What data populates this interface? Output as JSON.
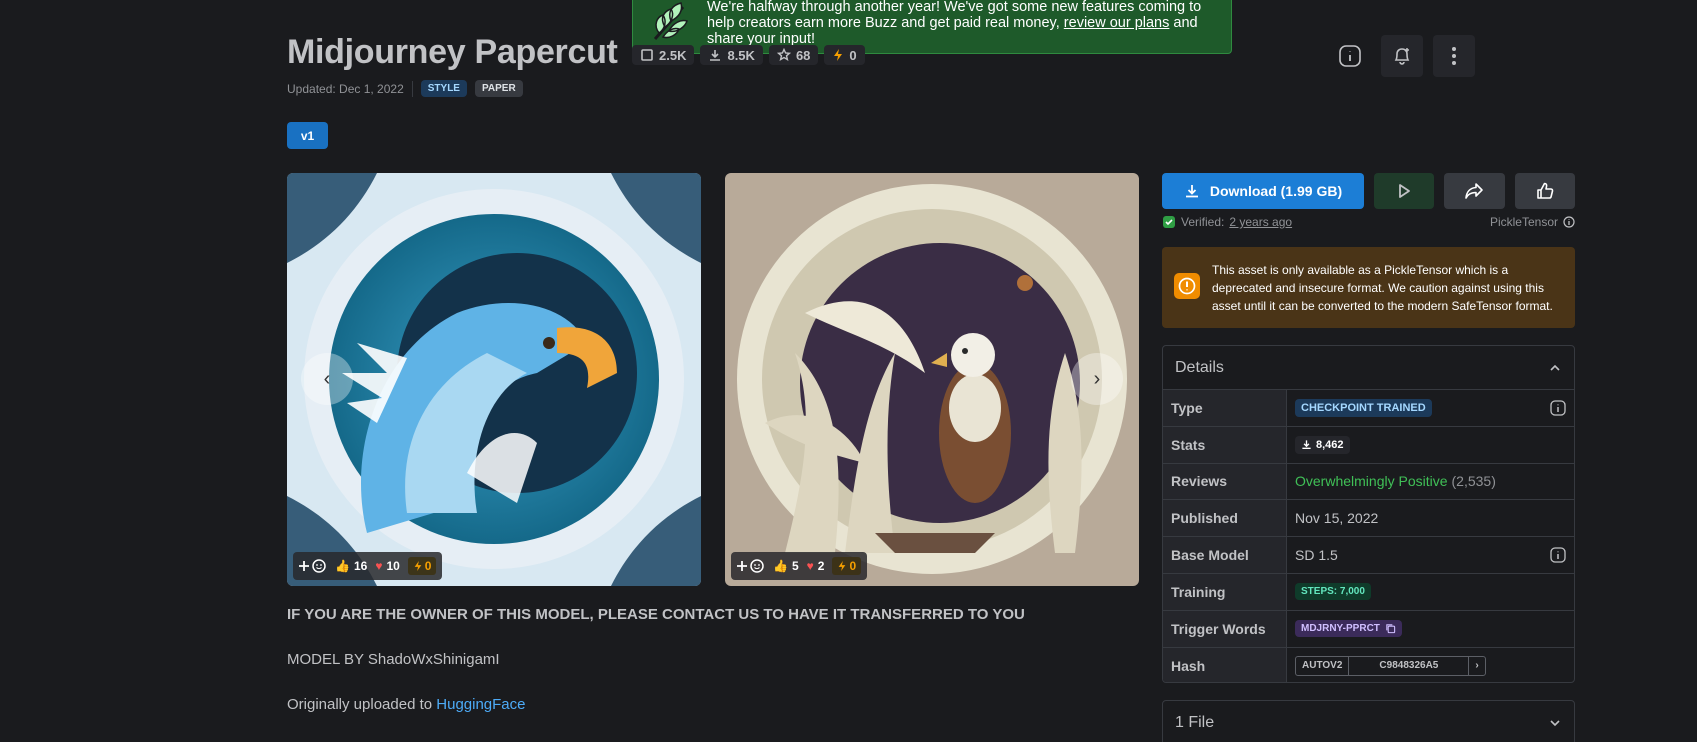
{
  "banner": {
    "text_before": "We're halfway through another year! We've got some new features coming to help creators earn more Buzz and get paid real money, ",
    "link": "review our plans",
    "text_after": " and share your input!"
  },
  "model": {
    "title": "Midjourney Papercut",
    "stats": [
      {
        "icon": "like-icon",
        "value": "2.5K"
      },
      {
        "icon": "download-icon",
        "value": "8.5K"
      },
      {
        "icon": "bookmark-icon",
        "value": "68"
      },
      {
        "icon": "buzz-icon",
        "value": "0"
      }
    ],
    "updated": "Updated: Dec 1, 2022",
    "tags": [
      "STYLE",
      "PAPER"
    ],
    "version": "v1"
  },
  "gallery": [
    {
      "likes": "16",
      "hearts": "10",
      "buzz": "0"
    },
    {
      "likes": "5",
      "hearts": "2",
      "buzz": "0"
    }
  ],
  "description": {
    "owner_notice": "IF YOU ARE THE OWNER OF THIS MODEL, PLEASE CONTACT US TO HAVE IT TRANSFERRED TO YOU",
    "model_by": "MODEL BY ShadoWxShinigamI",
    "uploaded_prefix": "Originally uploaded to ",
    "uploaded_link": "HuggingFace"
  },
  "download": {
    "label": "Download (1.99 GB)",
    "verified_prefix": "Verified: ",
    "verified_when": "2 years ago",
    "format": "PickleTensor"
  },
  "warning": {
    "text": "This asset is only available as a PickleTensor which is a deprecated and insecure format. We caution against using this asset until it can be converted to the modern SafeTensor format."
  },
  "details": {
    "header": "Details",
    "rows": {
      "type": {
        "label": "Type",
        "value": "CHECKPOINT TRAINED"
      },
      "stats": {
        "label": "Stats",
        "value": "8,462"
      },
      "reviews": {
        "label": "Reviews",
        "value": "Overwhelmingly Positive",
        "count": "(2,535)"
      },
      "published": {
        "label": "Published",
        "value": "Nov 15, 2022"
      },
      "base_model": {
        "label": "Base Model",
        "value": "SD 1.5"
      },
      "training": {
        "label": "Training",
        "value": "STEPS: 7,000"
      },
      "trigger": {
        "label": "Trigger Words",
        "value": "MDJRNY-PPRCT"
      },
      "hash": {
        "label": "Hash",
        "type": "AUTOV2",
        "value": "C9848326A5"
      }
    }
  },
  "files": {
    "label": "1 File"
  },
  "colors": {
    "accent": "#1c7ed6",
    "positive": "#40c057",
    "warning_bg": "#4a3417",
    "banner_bg": "#1e5a2a"
  }
}
